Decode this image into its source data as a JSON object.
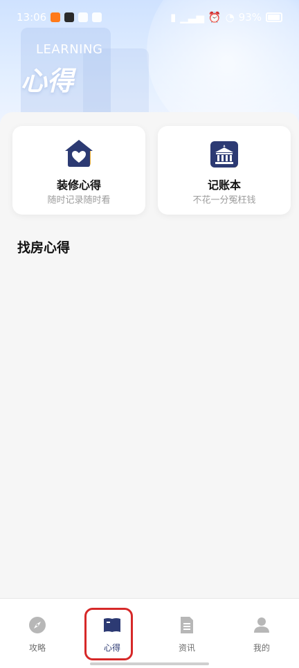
{
  "status_bar": {
    "time": "13:06",
    "battery": "93%"
  },
  "header": {
    "subtitle": "LEARNING",
    "title": "心得"
  },
  "cards": [
    {
      "title": "装修心得",
      "subtitle": "随时记录随时看",
      "icon": "house-heart-icon"
    },
    {
      "title": "记账本",
      "subtitle": "不花一分冤枉钱",
      "icon": "building-icon"
    }
  ],
  "section": {
    "title": "找房心得"
  },
  "tabbar": {
    "items": [
      {
        "label": "攻略",
        "icon": "compass-icon",
        "active": false
      },
      {
        "label": "心得",
        "icon": "book-icon",
        "active": true
      },
      {
        "label": "资讯",
        "icon": "document-icon",
        "active": false
      },
      {
        "label": "我的",
        "icon": "user-icon",
        "active": false
      }
    ]
  },
  "colors": {
    "accent": "#2c3a73",
    "secondary": "#f2b53a",
    "highlight": "#d62828"
  }
}
